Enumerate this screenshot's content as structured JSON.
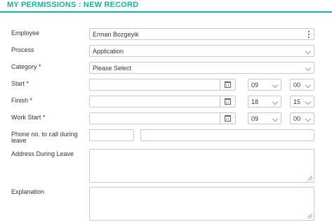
{
  "header": {
    "title": "MY PERMISSIONS : NEW RECORD"
  },
  "form": {
    "employee": {
      "label": "Employee",
      "value": "Erman Bozgeyik"
    },
    "process": {
      "label": "Process",
      "value": "Application"
    },
    "category": {
      "label": "Category *",
      "value": "Please Select"
    },
    "start": {
      "label": "Start *",
      "date": "",
      "hour": "09",
      "minute": "00"
    },
    "finish": {
      "label": "Finish *",
      "date": "",
      "hour": "18",
      "minute": "15"
    },
    "work_start": {
      "label": "Work Start *",
      "date": "",
      "hour": "09",
      "minute": "00"
    },
    "phone": {
      "label": "Phone no. to call during leave",
      "code": "",
      "number": ""
    },
    "address": {
      "label": "Address During Leave",
      "value": ""
    },
    "explanation": {
      "label": "Explanation",
      "value": ""
    }
  },
  "colors": {
    "accent": "#1aaea3",
    "border": "#c7c7c7",
    "text": "#333333"
  },
  "icons": [
    "kebab-menu-icon",
    "chevron-down-icon",
    "calendar-icon",
    "resize-handle-icon"
  ]
}
